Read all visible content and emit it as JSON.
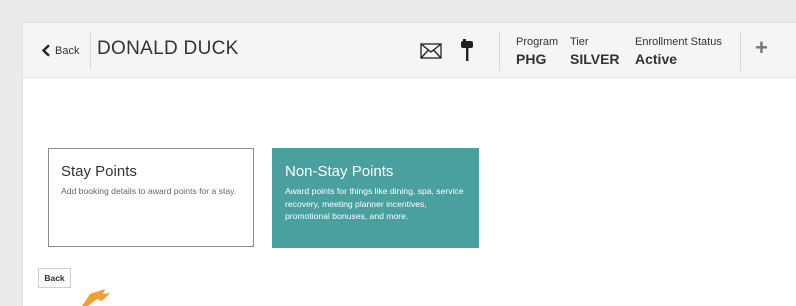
{
  "header": {
    "back_label": "Back",
    "member_name": "DONALD DUCK",
    "icons": [
      "mail-icon",
      "mailbox-icon"
    ],
    "program": {
      "label": "Program",
      "value": "PHG"
    },
    "tier": {
      "label": "Tier",
      "value": "SILVER"
    },
    "enrollment_status": {
      "label": "Enrollment Status",
      "value": "Active"
    },
    "add_label": "+"
  },
  "cards": {
    "stay": {
      "title": "Stay Points",
      "description": "Add booking details to award points for a stay."
    },
    "non_stay": {
      "title": "Non-Stay Points",
      "description": "Award points for things like dining, spa, service recovery, meeting planner incentives, promotional bonuses, and more."
    }
  },
  "footer": {
    "back_button_label": "Back"
  },
  "colors": {
    "accent_teal": "#4a9f9f",
    "cursor_orange": "#f0a030",
    "header_bg": "#f5f5f5"
  }
}
